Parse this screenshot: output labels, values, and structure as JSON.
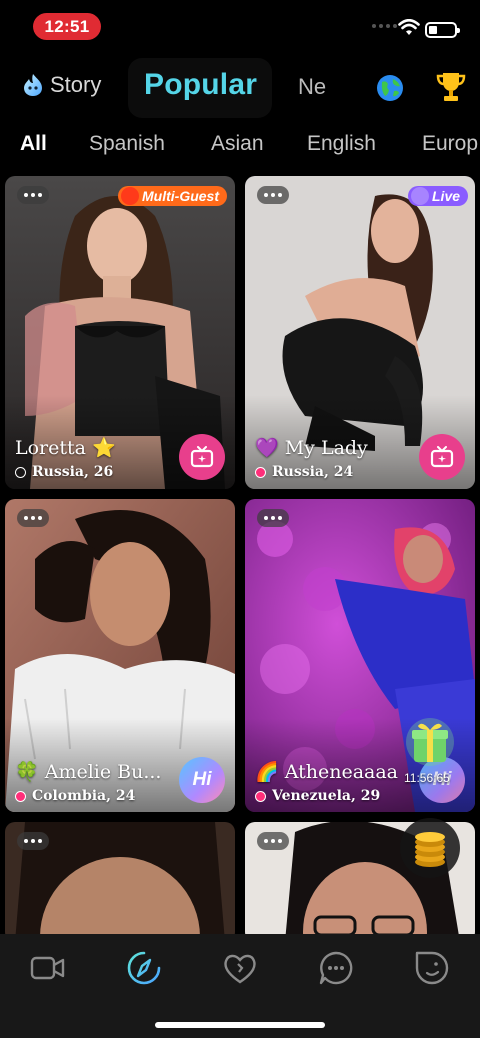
{
  "status_bar": {
    "time": "12:51"
  },
  "top_nav": {
    "story_label": "Story",
    "popular_label": "Popular",
    "new_label_partial": "Ne"
  },
  "language_tabs": [
    "All",
    "Spanish",
    "Asian",
    "English",
    "Europ"
  ],
  "cards": [
    {
      "name": "Loretta",
      "name_emoji": "⭐",
      "location": "Russia, 26",
      "online": false,
      "badge": "Multi-Guest",
      "action": "live-room"
    },
    {
      "name": "My Lady",
      "name_emoji": "💜",
      "location": "Russia, 24",
      "online": true,
      "badge": "Live",
      "action": "live-room"
    },
    {
      "name": "Amelie Bu...",
      "name_emoji": "🍀",
      "location": "Colombia, 24",
      "online": true,
      "badge": "",
      "action": "hi"
    },
    {
      "name": "Atheneaaaa",
      "name_emoji": "🌈",
      "location": "Venezuela, 29",
      "online": true,
      "badge": "",
      "action": "hi"
    },
    {
      "name": "",
      "location": "",
      "badge": ""
    },
    {
      "name": "",
      "location": "",
      "badge": ""
    }
  ],
  "hi_label": "Hi",
  "gift_countdown": "11:56:65",
  "bottom_tabs": [
    "video-call",
    "discover",
    "likes",
    "messages",
    "profile"
  ],
  "colors": {
    "accent": "#55d5e8",
    "live_pink": "#e83f8c",
    "multi_guest_orange": "#ff6a1a",
    "live_purple": "#8a5cff",
    "status_red": "#e02b33"
  }
}
